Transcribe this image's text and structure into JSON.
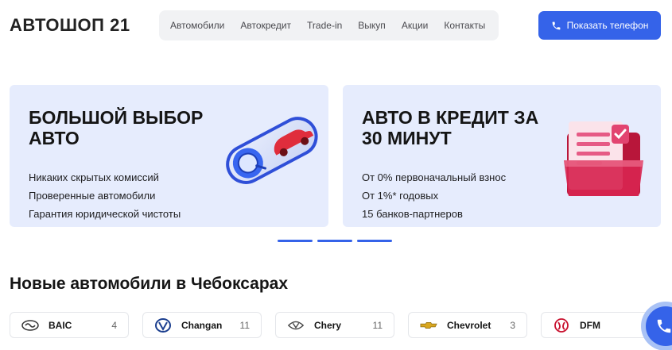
{
  "header": {
    "logo": "АВТОШОП 21",
    "nav": [
      "Автомобили",
      "Автокредит",
      "Trade-in",
      "Выкуп",
      "Акции",
      "Контакты"
    ],
    "phone_button": "Показать телефон"
  },
  "banners": [
    {
      "title_line1": "БОЛЬШОЙ ВЫБОР",
      "title_line2": "АВТО",
      "items": [
        "Никаких скрытых комиссий",
        "Проверенные автомобили",
        "Гарантия юридической чистоты"
      ]
    },
    {
      "title_line1": "АВТО В КРЕДИТ ЗА",
      "title_line2": "30 МИНУТ",
      "items": [
        "От 0% первоначальный взнос",
        "От 1%* годовых",
        "15 банков-партнеров"
      ]
    }
  ],
  "section": {
    "title": "Новые автомобили в Чебоксарах"
  },
  "brands": [
    {
      "name": "BAIC",
      "count": "4",
      "icon": "baic-logo-icon"
    },
    {
      "name": "Changan",
      "count": "11",
      "icon": "changan-logo-icon"
    },
    {
      "name": "Chery",
      "count": "11",
      "icon": "chery-logo-icon"
    },
    {
      "name": "Chevrolet",
      "count": "3",
      "icon": "chevrolet-logo-icon"
    },
    {
      "name": "DFM",
      "count": "",
      "icon": "dfm-logo-icon"
    }
  ],
  "colors": {
    "accent": "#3563e9",
    "banner_bg": "#e6ecfd",
    "nav_bg": "#f1f2f4"
  }
}
